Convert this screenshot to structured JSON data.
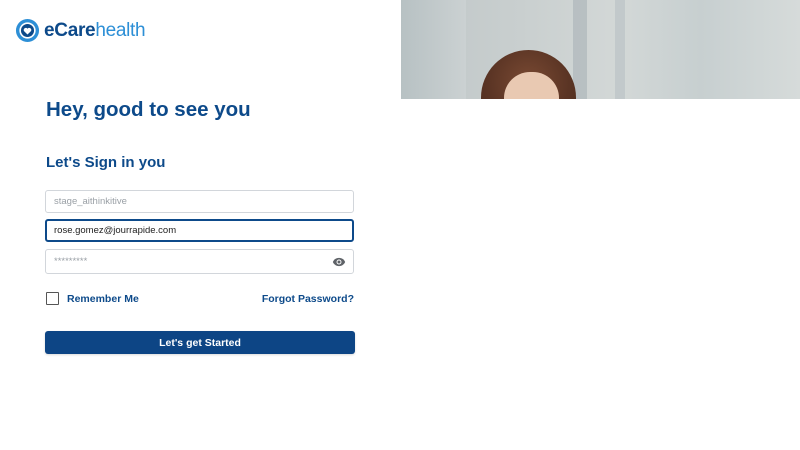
{
  "brand": {
    "name_part1": "eCare",
    "name_part2": "health",
    "primary_color": "#0d4a8a",
    "accent_color": "#2d8fd6"
  },
  "hero_image": {
    "icon": "person-photo"
  },
  "heading": "Hey, good to see you",
  "subheading": "Let's Sign in you",
  "form": {
    "username": {
      "placeholder": "stage_aithinkitive",
      "value": ""
    },
    "email": {
      "value": "rose.gomez@jourrapide.com"
    },
    "password": {
      "placeholder": "*********",
      "icon": "eye-icon"
    },
    "remember_me_label": "Remember Me",
    "remember_me_checked": false,
    "forgot_password_label": "Forgot Password?",
    "submit_label": "Let's get Started"
  }
}
